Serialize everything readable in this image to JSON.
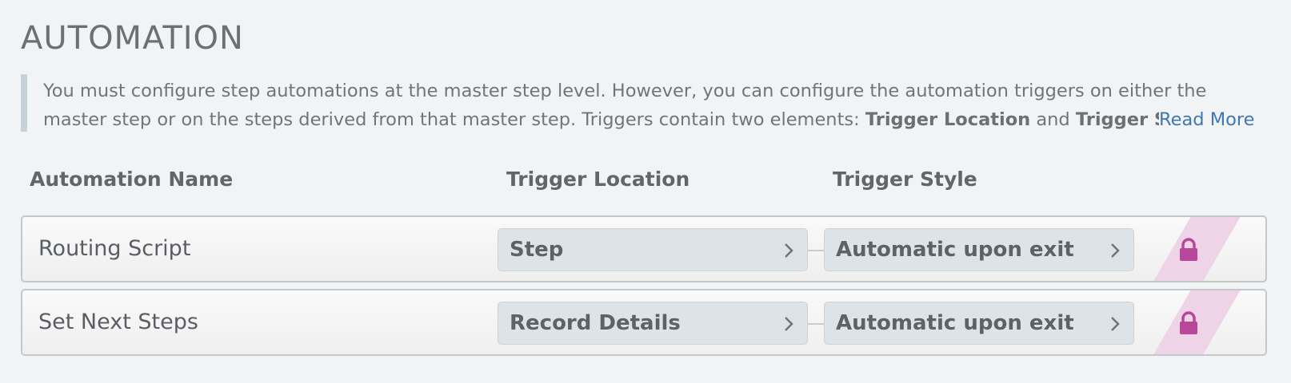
{
  "section": {
    "title": "AUTOMATION"
  },
  "info": {
    "line1": "You must configure step automations at the master step level. However, you can configure the automation triggers on either the",
    "line2_prefix": "master step or on the steps derived from that master step. Triggers contain two elements: ",
    "line2_bold1": "Trigger Location",
    "line2_mid": " and ",
    "line2_bold2": "Trigger Style",
    "read_more": "Read More"
  },
  "table": {
    "headers": {
      "name": "Automation Name",
      "location": "Trigger Location",
      "style": "Trigger Style"
    },
    "rows": [
      {
        "name": "Routing Script",
        "location": "Step",
        "style": "Automatic upon exit",
        "locked_icon": "lock-icon"
      },
      {
        "name": "Set Next Steps",
        "location": "Record Details",
        "style": "Automatic upon exit",
        "locked_icon": "lock-icon"
      }
    ]
  },
  "colors": {
    "background": "#f2f3f5",
    "link": "#3f78b0",
    "lock": "#b8479a",
    "lock_stripe": "#eed4e6",
    "selector_bg": "#dde3e6",
    "info_border": "#c7d2d8"
  }
}
